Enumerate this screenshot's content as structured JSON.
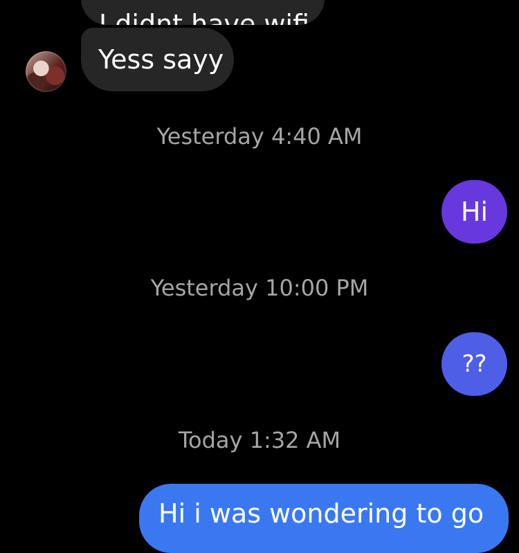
{
  "conversation": {
    "messages": [
      {
        "direction": "incoming",
        "text": "I didnt have wifi"
      },
      {
        "direction": "incoming",
        "text": "Yess sayy"
      },
      {
        "direction": "outgoing",
        "text": "Hi"
      },
      {
        "direction": "outgoing",
        "text": "??"
      },
      {
        "direction": "outgoing",
        "text": "Hi i was wondering to go"
      }
    ],
    "timestamps": [
      "Yesterday 4:40 AM",
      "Yesterday 10:00 PM",
      "Today 1:32 AM"
    ]
  },
  "contact": {
    "avatar_icon": "contact-avatar-photo"
  },
  "colors": {
    "background": "#000000",
    "incoming_bubble": "#262626",
    "timestamp_text": "#a6a6a6",
    "outgoing_bubble_top": "#6638dd",
    "outgoing_bubble_middle": "#4f5ee7",
    "outgoing_bubble_bottom": "#3a78f2"
  }
}
